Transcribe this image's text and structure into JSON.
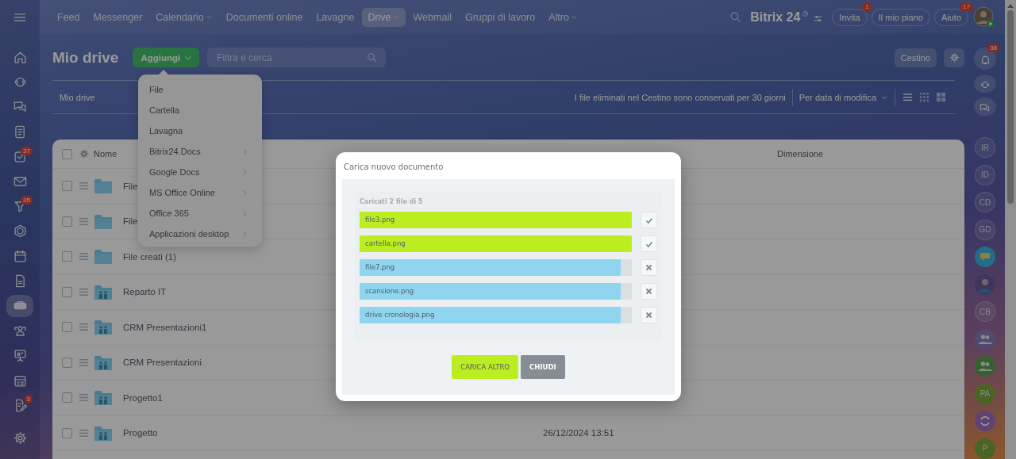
{
  "top_nav": {
    "items": [
      {
        "label": "Feed",
        "selected": false,
        "dropdown": false
      },
      {
        "label": "Messenger",
        "selected": false,
        "dropdown": false
      },
      {
        "label": "Calendario",
        "selected": false,
        "dropdown": true
      },
      {
        "label": "Documenti online",
        "selected": false,
        "dropdown": false
      },
      {
        "label": "Lavagne",
        "selected": false,
        "dropdown": false
      },
      {
        "label": "Drive",
        "selected": true,
        "dropdown": true
      },
      {
        "label": "Webmail",
        "selected": false,
        "dropdown": false
      },
      {
        "label": "Gruppi di lavoro",
        "selected": false,
        "dropdown": false
      },
      {
        "label": "Altro",
        "selected": false,
        "dropdown": true
      }
    ]
  },
  "brand": {
    "name": "Bitrix",
    "number": "24"
  },
  "header_buttons": [
    {
      "label": "Invita",
      "badge": "1"
    },
    {
      "label": "Il mio piano"
    },
    {
      "label": "Aiuto",
      "badge": "17"
    }
  ],
  "left_nav": {
    "items": [
      {
        "kind": "home",
        "selected": false
      },
      {
        "kind": "loop",
        "selected": false
      },
      {
        "kind": "chat",
        "selected": false
      },
      {
        "kind": "notebook",
        "selected": false
      },
      {
        "kind": "checklist",
        "selected": false,
        "badge": "37"
      },
      {
        "kind": "mail",
        "selected": false
      },
      {
        "kind": "funnel",
        "selected": false,
        "badge": "35"
      },
      {
        "kind": "hexagon",
        "selected": false
      },
      {
        "kind": "calendar",
        "selected": false
      },
      {
        "kind": "document",
        "selected": false
      },
      {
        "kind": "drive",
        "selected": true
      },
      {
        "kind": "people",
        "selected": false
      },
      {
        "kind": "board",
        "selected": false
      },
      {
        "kind": "schedule",
        "selected": false
      },
      {
        "kind": "pen-document",
        "selected": false,
        "badge": "3"
      },
      {
        "kind": "settings",
        "selected": false
      }
    ]
  },
  "page": {
    "title": "Mio drive",
    "add_button": "Aggiungi",
    "search_placeholder": "Filtra e cerca",
    "trash_button": "Cestino"
  },
  "breadcrumb": "Mio drive",
  "notice": "I file eliminati nel Cestino sono conservati per 30 giorni",
  "sort": "Per data di modifica",
  "view_modes": [
    {
      "kind": "list",
      "selected": true
    },
    {
      "kind": "tiles",
      "selected": false
    },
    {
      "kind": "grid",
      "selected": false
    }
  ],
  "add_menu": {
    "items": [
      {
        "label": "File",
        "submenu": false
      },
      {
        "label": "Cartella",
        "submenu": false
      },
      {
        "label": "Lavagna",
        "submenu": false
      },
      {
        "label": "Bitrix24.Docs",
        "submenu": true
      },
      {
        "label": "Google Docs",
        "submenu": true
      },
      {
        "label": "MS Office Online",
        "submenu": true
      },
      {
        "label": "Office 365",
        "submenu": true
      },
      {
        "label": "Applicazioni desktop",
        "submenu": true
      }
    ]
  },
  "table": {
    "columns": [
      "Nome",
      "Dimensione"
    ],
    "select_all_checked": false,
    "rows": [
      {
        "name": "File",
        "kind": "folder",
        "checked": false
      },
      {
        "name": "File",
        "kind": "folder",
        "checked": false
      },
      {
        "name": "File creati (1)",
        "kind": "folder",
        "checked": false
      },
      {
        "name": "Reparto IT",
        "kind": "shared",
        "checked": false
      },
      {
        "name": "CRM Presentazioni1",
        "kind": "shared",
        "checked": false
      },
      {
        "name": "CRM Presentazioni",
        "kind": "shared",
        "checked": false
      },
      {
        "name": "Progetto1",
        "kind": "shared",
        "checked": false
      },
      {
        "name": "Progetto",
        "kind": "shared",
        "checked": false,
        "modified": "26/12/2024 13:51"
      }
    ]
  },
  "right_rail": {
    "notifications": "38",
    "items": [
      {
        "kind": "initials",
        "text": "IR"
      },
      {
        "kind": "initials",
        "text": "ID"
      },
      {
        "kind": "initials",
        "text": "CD"
      },
      {
        "kind": "initials",
        "text": "GD"
      },
      {
        "kind": "chat"
      },
      {
        "kind": "photo"
      },
      {
        "kind": "initials",
        "text": "CB"
      },
      {
        "kind": "group"
      },
      {
        "kind": "team"
      },
      {
        "kind": "project",
        "text": "PA"
      },
      {
        "kind": "loop"
      },
      {
        "kind": "project",
        "text": "P"
      }
    ]
  },
  "dialog": {
    "title": "Carica nuovo documento",
    "status": "Caricati 2 file di 5",
    "files": [
      {
        "name": "file3.png",
        "done": true,
        "level": 1
      },
      {
        "name": "cartella.png",
        "done": true,
        "level": 1
      },
      {
        "name": "file7.png",
        "done": false,
        "level": 0.96
      },
      {
        "name": "scansione.png",
        "done": false,
        "level": 0.96
      },
      {
        "name": "drive cronologia.png",
        "done": false,
        "level": 0.96
      }
    ],
    "buttons": [
      {
        "label": "CARICA ALTRO",
        "kind": "primary"
      },
      {
        "label": "CHIUDI",
        "kind": "secondary"
      }
    ]
  }
}
